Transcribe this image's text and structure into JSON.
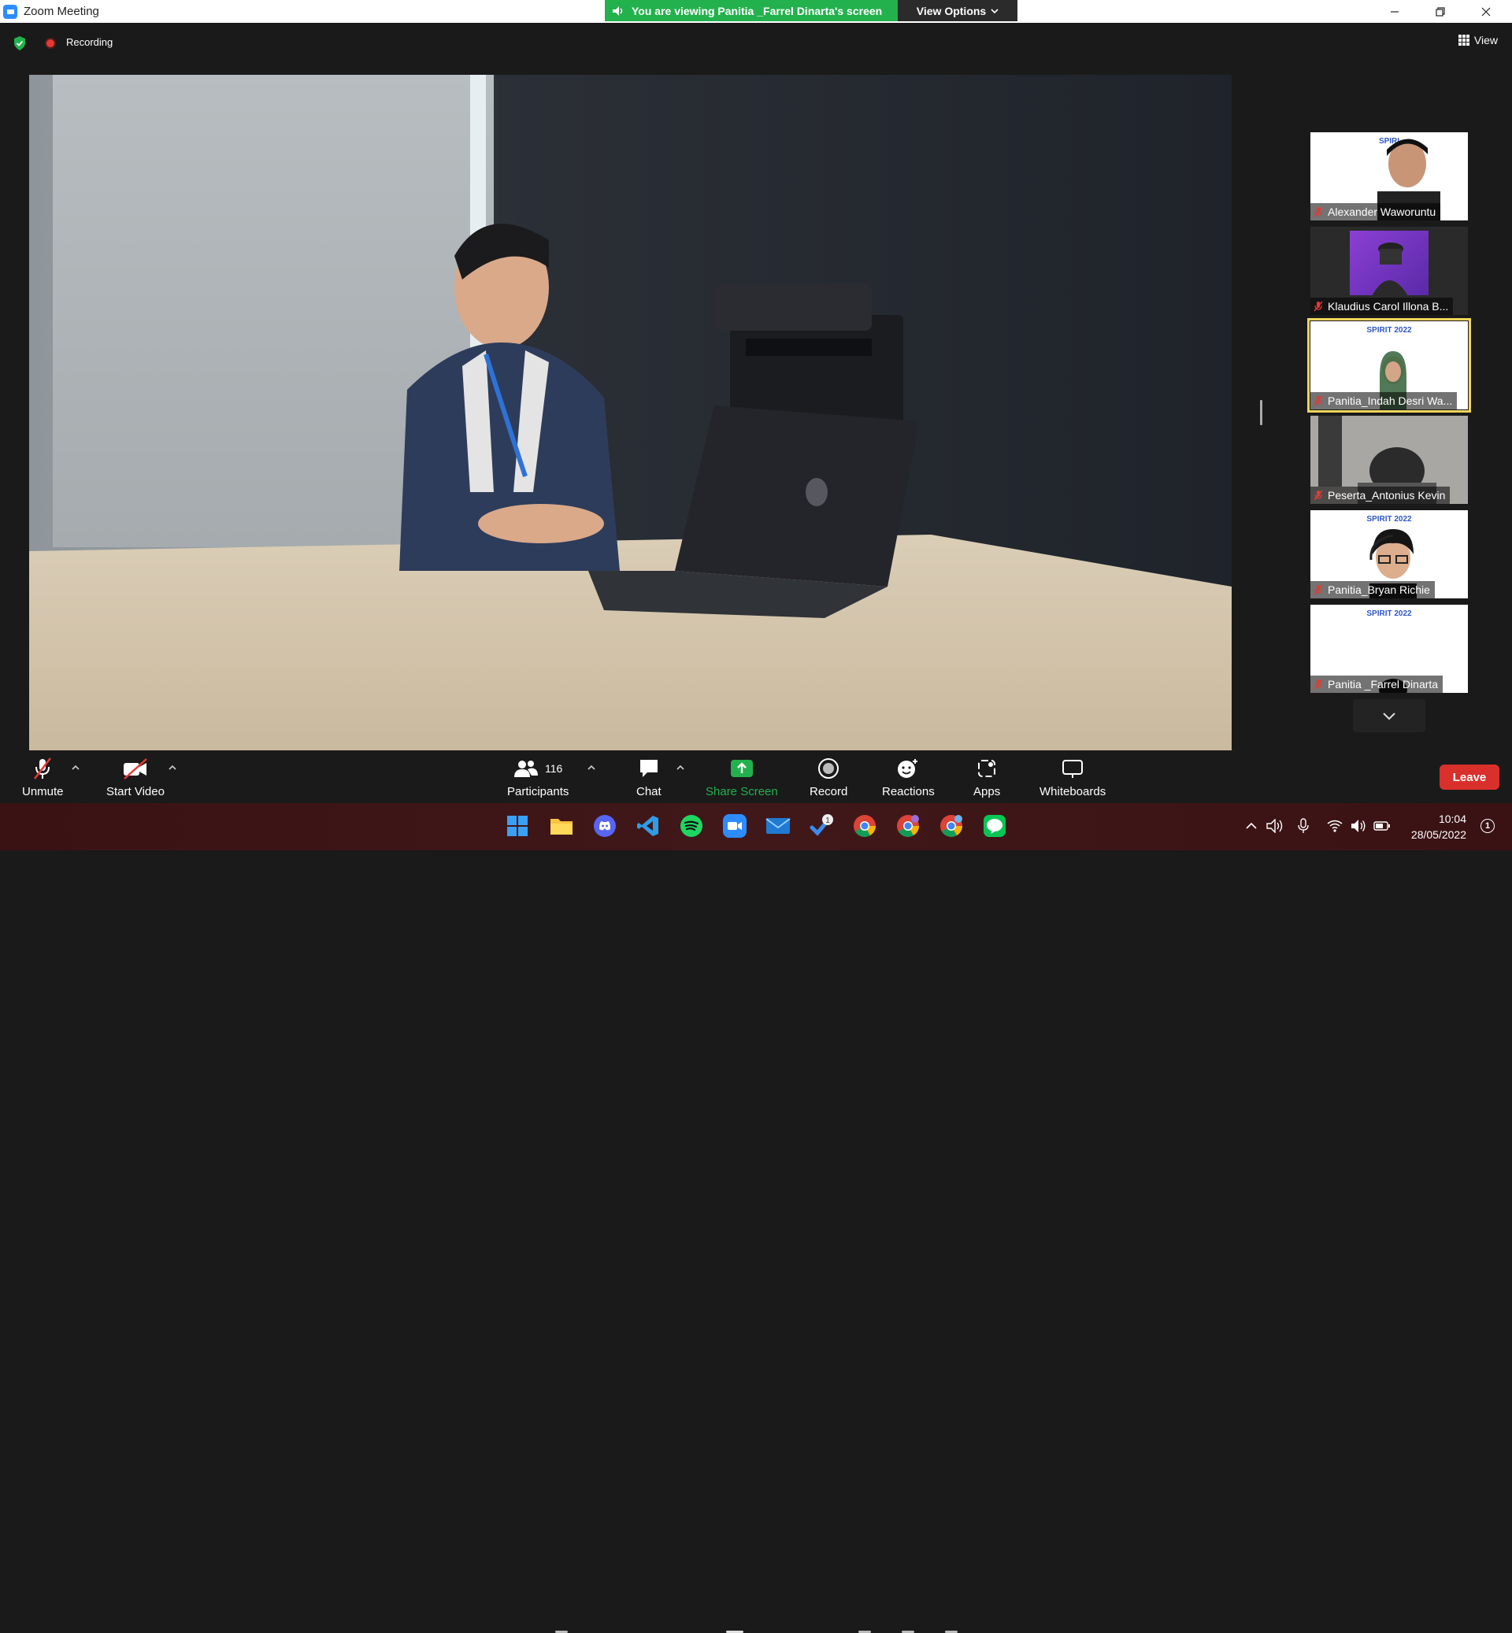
{
  "window": {
    "title": "Zoom Meeting"
  },
  "share_banner": {
    "text": "You are viewing Panitia _Farrel Dinarta's screen",
    "color": "#23B14D"
  },
  "view_options": {
    "label": "View Options"
  },
  "recording": {
    "label": "Recording"
  },
  "view": {
    "label": "View"
  },
  "participants_panel": {
    "tiles": [
      {
        "name": "Alexander Waworuntu",
        "type": "video-slide",
        "slide_title": "SPIRI",
        "muted": true
      },
      {
        "name": "Klaudius Carol Illona B...",
        "type": "avatar",
        "muted": true
      },
      {
        "name": "Panitia_Indah Desri Wa...",
        "type": "video-slide",
        "slide_title": "SPIRIT 2022",
        "muted": true,
        "active_speaker": true
      },
      {
        "name": "Peserta_Antonius Kevin",
        "type": "video-room",
        "muted": true
      },
      {
        "name": "Panitia_Bryan Richie",
        "type": "video-slide",
        "slide_title": "SPIRIT 2022",
        "muted": true
      },
      {
        "name": "Panitia _Farrel Dinarta",
        "type": "video-slide",
        "slide_title": "SPIRIT 2022",
        "muted": true
      }
    ]
  },
  "toolbar": {
    "unmute": "Unmute",
    "start_video": "Start Video",
    "participants": "Participants",
    "participants_count": "116",
    "chat": "Chat",
    "share_screen": "Share Screen",
    "record": "Record",
    "reactions": "Reactions",
    "apps": "Apps",
    "whiteboards": "Whiteboards",
    "leave": "Leave",
    "share_color": "#23B14D",
    "leave_color": "#D9302C"
  },
  "taskbar": {
    "apps": [
      "windows-start",
      "file-explorer",
      "discord",
      "vscode",
      "spotify",
      "zoom",
      "mail",
      "todo",
      "chrome",
      "chrome",
      "chrome",
      "line"
    ],
    "badges": {
      "todo": "1"
    },
    "time": "10:04",
    "date": "28/05/2022",
    "notifications": "1"
  }
}
